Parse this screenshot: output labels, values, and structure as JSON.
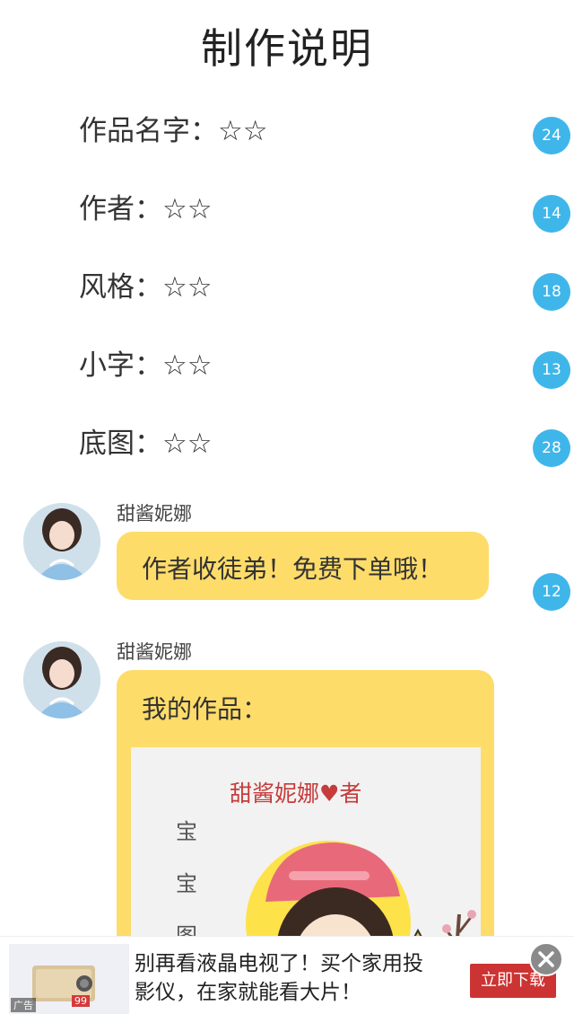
{
  "title": "制作说明",
  "info_rows": [
    {
      "label": "作品名字：☆☆",
      "count": "24"
    },
    {
      "label": "作者：☆☆",
      "count": "14"
    },
    {
      "label": "风格：☆☆",
      "count": "18"
    },
    {
      "label": "小字：☆☆",
      "count": "13"
    },
    {
      "label": "底图：☆☆",
      "count": "28"
    }
  ],
  "messages": [
    {
      "sender": "甜酱妮娜",
      "text": "作者收徒弟！免费下单哦！",
      "count": "12"
    },
    {
      "sender": "甜酱妮娜",
      "text": "我的作品："
    }
  ],
  "artwork": {
    "banner": "甜酱妮娜♥者",
    "side_chars": [
      "宝",
      "宝",
      "图"
    ]
  },
  "ad": {
    "text_line1": "别再看液晶电视了！买个家用投",
    "text_line2": "影仪，在家就能看大片！",
    "button": "立即下载",
    "tag": "广告",
    "price": "99"
  },
  "colors": {
    "badge": "#3fb6ea",
    "bubble": "#fddc6a",
    "ad_button": "#cc3333"
  }
}
